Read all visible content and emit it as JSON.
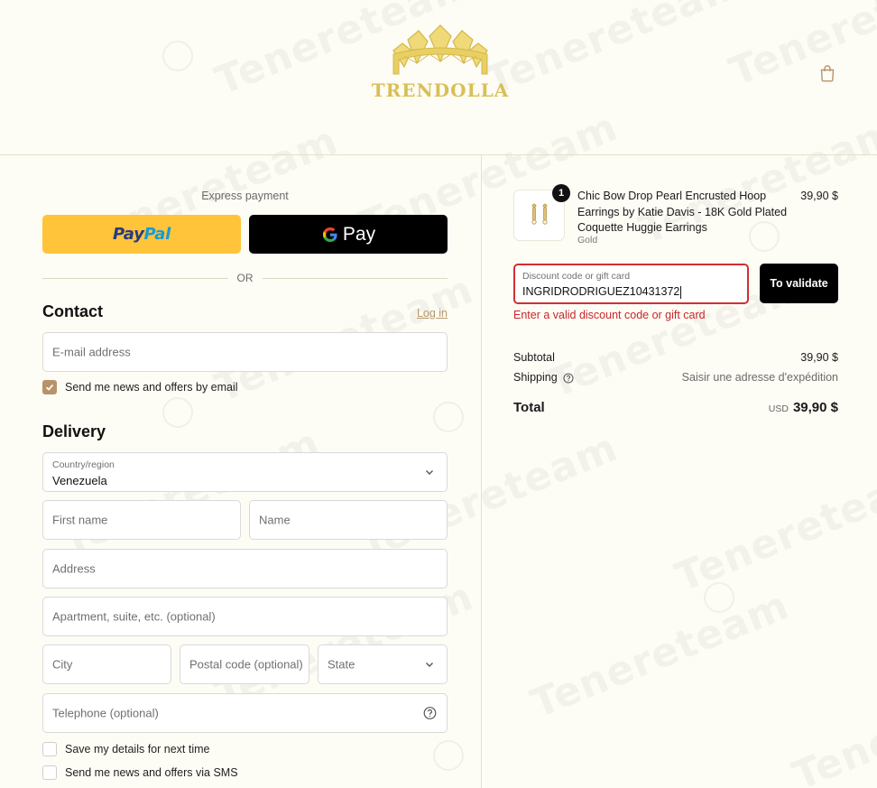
{
  "brand": {
    "name": "TRENDOLLA",
    "color": "#d9bf55"
  },
  "watermark": {
    "text": "Tenereteam"
  },
  "header": {
    "cart_icon": "shopping-bag-icon"
  },
  "express": {
    "label": "Express payment",
    "paypal": {
      "part1": "Pay",
      "part2": "Pal"
    },
    "gpay": {
      "label": "Pay"
    },
    "or": "OR"
  },
  "contact": {
    "title": "Contact",
    "login": "Log in",
    "email_placeholder": "E-mail address",
    "newsletter_label": "Send me news and offers by email",
    "newsletter_checked": true
  },
  "delivery": {
    "title": "Delivery",
    "country_label": "Country/region",
    "country_value": "Venezuela",
    "first_name": "First name",
    "last_name": "Name",
    "address": "Address",
    "apartment": "Apartment, suite, etc. (optional)",
    "city": "City",
    "postal": "Postal code (optional)",
    "state": "State",
    "phone": "Telephone (optional)",
    "save_details": "Save my details for next time",
    "sms": "Send me news and offers via SMS"
  },
  "order": {
    "quantity": "1",
    "product_title": "Chic Bow Drop Pearl Encrusted Hoop Earrings by Katie Davis - 18K Gold Plated Coquette Huggie Earrings",
    "variant": "Gold",
    "price": "39,90 $",
    "discount_label": "Discount code or gift card",
    "discount_value": "INGRIDRODRIGUEZ10431372",
    "validate": "To validate",
    "discount_error": "Enter a valid discount code or gift card",
    "subtotal_label": "Subtotal",
    "subtotal_value": "39,90 $",
    "shipping_label": "Shipping",
    "shipping_value": "Saisir une adresse d'expédition",
    "total_label": "Total",
    "total_currency": "USD",
    "total_value": "39,90 $",
    "error_color": "#c9262b"
  }
}
